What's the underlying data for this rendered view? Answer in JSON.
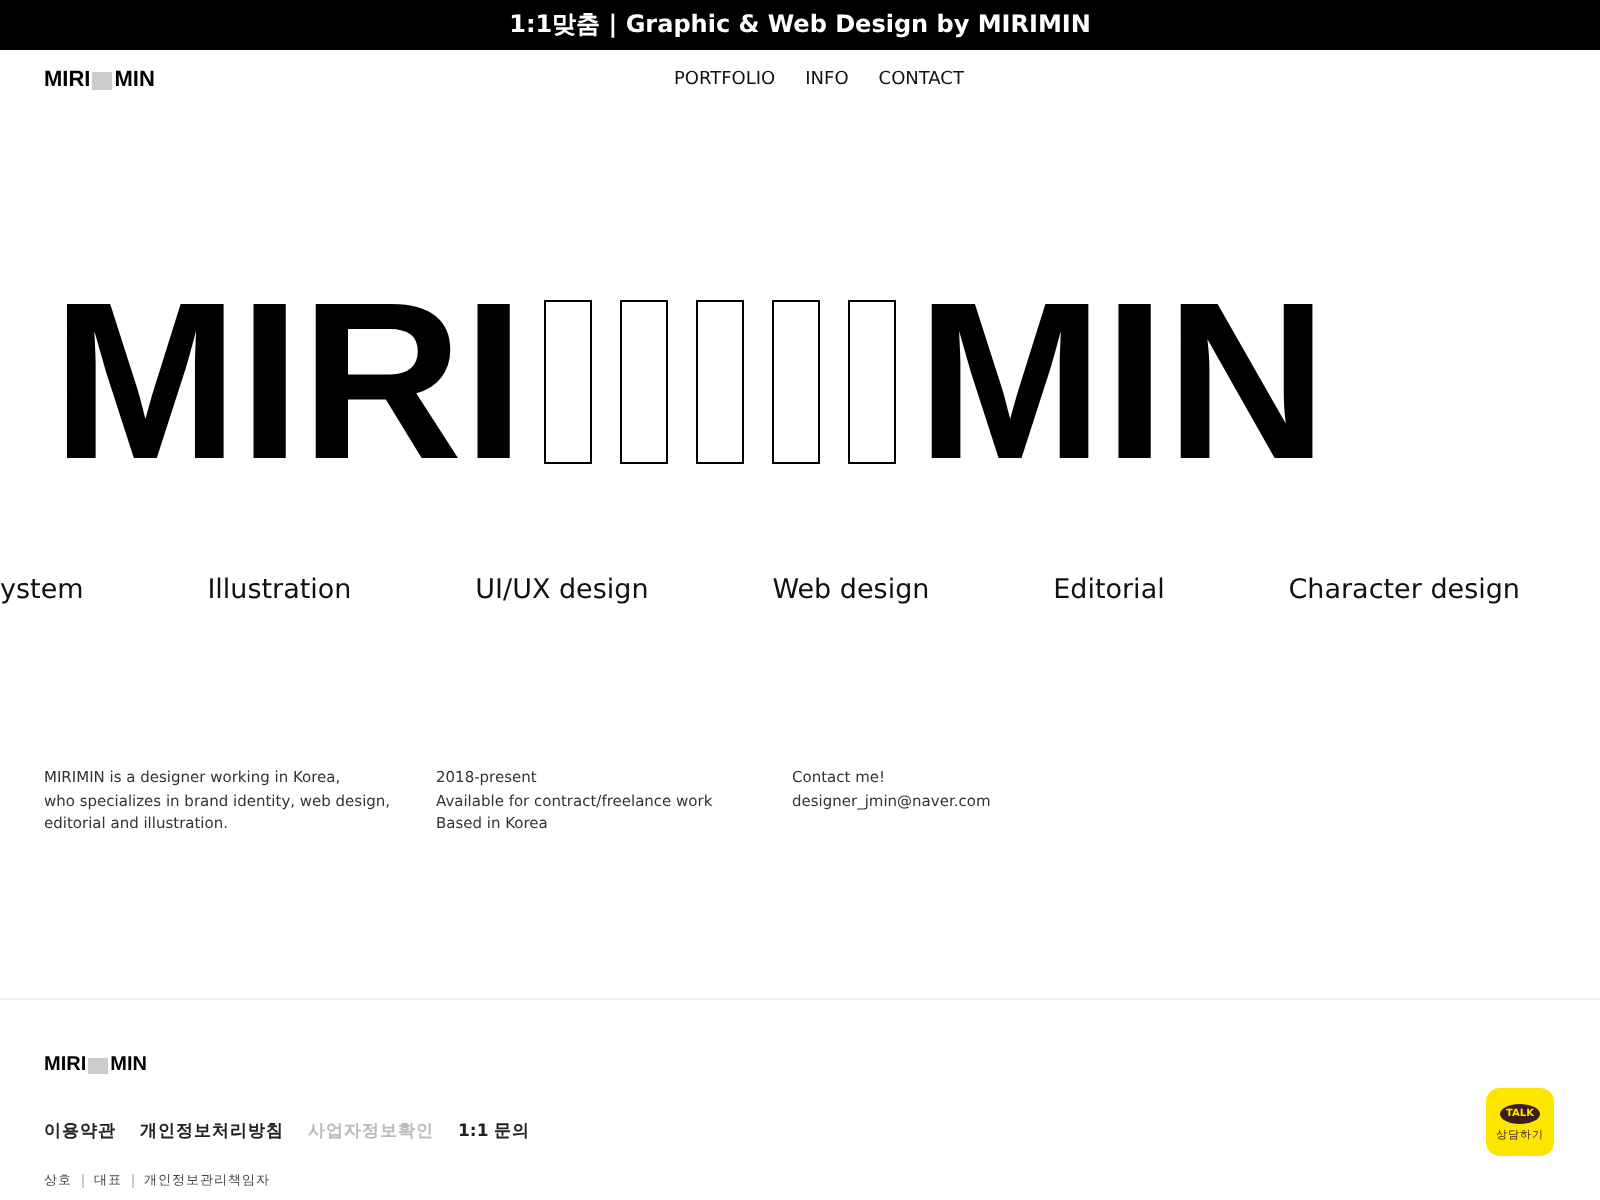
{
  "top_banner": {
    "text": "1:1맞춤 | Graphic & Web Design by MIRIMIN"
  },
  "header": {
    "logo": {
      "left": "MIRI",
      "right": "MIN"
    },
    "nav": [
      "PORTFOLIO",
      "INFO",
      "CONTACT"
    ]
  },
  "hero": {
    "left": "MIRI",
    "right": "MIN"
  },
  "services": [
    "ystem",
    "Illustration",
    "UI/UX design",
    "Web design",
    "Editorial",
    "Character design"
  ],
  "info_columns": [
    {
      "lines": [
        "MIRIMIN is a designer working in Korea,",
        "who specializes in brand identity, web design,",
        "editorial and illustration."
      ]
    },
    {
      "lines": [
        "2018-present",
        "Available for contract/freelance work",
        "Based in Korea"
      ]
    },
    {
      "lines": [
        "Contact me!",
        "designer_jmin@naver.com"
      ]
    }
  ],
  "footer": {
    "logo": {
      "left": "MIRI",
      "right": "MIN"
    },
    "links": [
      {
        "label": "이용약관",
        "dimmed": false
      },
      {
        "label": "개인정보처리방침",
        "dimmed": false
      },
      {
        "label": "사업자정보확인",
        "dimmed": true
      },
      {
        "label": "1:1 문의",
        "dimmed": false
      }
    ],
    "company": [
      "상호",
      "대표",
      "개인정보관리책임자"
    ]
  },
  "chat_button": {
    "bubble": "TALK",
    "label": "상담하기"
  }
}
